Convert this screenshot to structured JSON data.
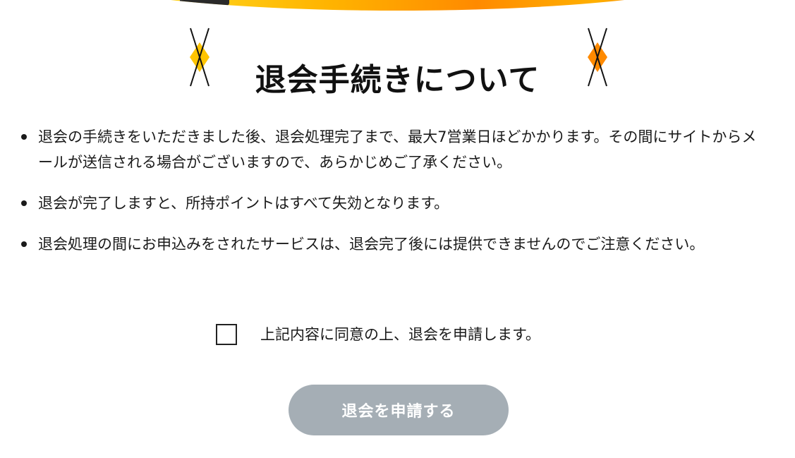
{
  "header": {
    "title": "退会手続きについて",
    "ornament_icon": "diamond-cross-ornament-icon"
  },
  "notices": [
    {
      "text": "退会の手続きをいただきました後、退会処理完了まで、最大7営業日ほどかかります。その間にサイトからメールが送信される場合がございますので、あらかじめご了承ください。"
    },
    {
      "text": "退会が完了しますと、所持ポイントはすべて失効となります。"
    },
    {
      "text": "退会処理の間にお申込みをされたサービスは、退会完了後には提供できませんのでご注意ください。"
    }
  ],
  "agreement": {
    "label": "上記内容に同意の上、退会を申請します。",
    "checked": false
  },
  "submit": {
    "label": "退会を申請する",
    "enabled": false
  },
  "colors": {
    "button_disabled": "#a5aeb5",
    "accent_yellow": "#ffc400",
    "accent_orange": "#ff8a00",
    "text": "#1a1a1a"
  }
}
